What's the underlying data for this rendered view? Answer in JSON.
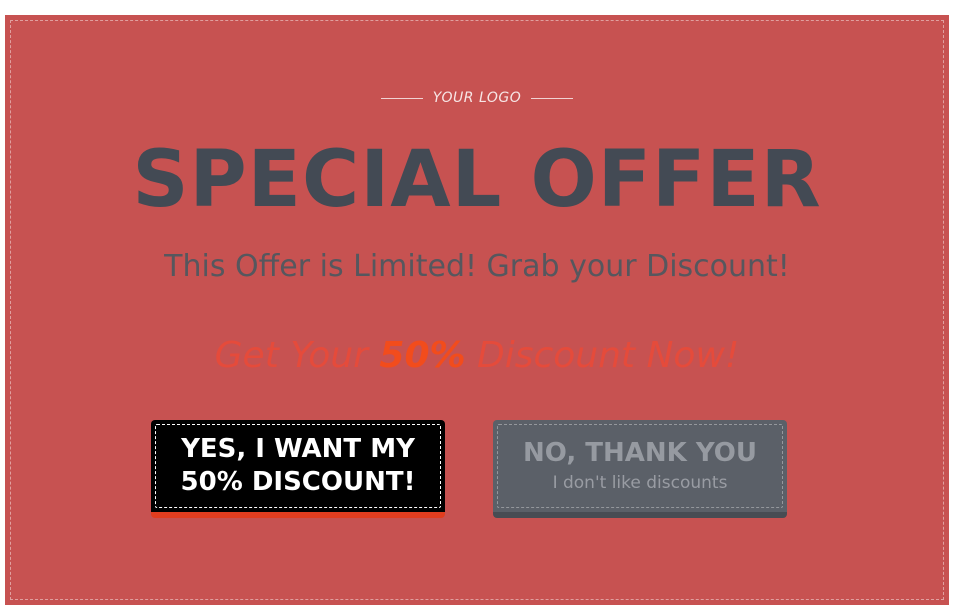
{
  "logo": {
    "text": "YOUR LOGO"
  },
  "offer": {
    "title": "SPECIAL OFFER",
    "subtitle": "This Offer is Limited! Grab your Discount!",
    "cta_prefix": "Get Your ",
    "cta_percent": "50%",
    "cta_suffix": " Discount Now!"
  },
  "buttons": {
    "yes": {
      "line1": "YES, I WANT MY",
      "line2": "50% DISCOUNT!"
    },
    "no": {
      "label": "NO, THANK YOU",
      "sublabel": "I don't like discounts"
    }
  },
  "colors": {
    "background": "#c75251",
    "title": "#434a54",
    "accent": "#f24c1c",
    "yes_button": "#000000",
    "no_button": "#5b6068"
  }
}
